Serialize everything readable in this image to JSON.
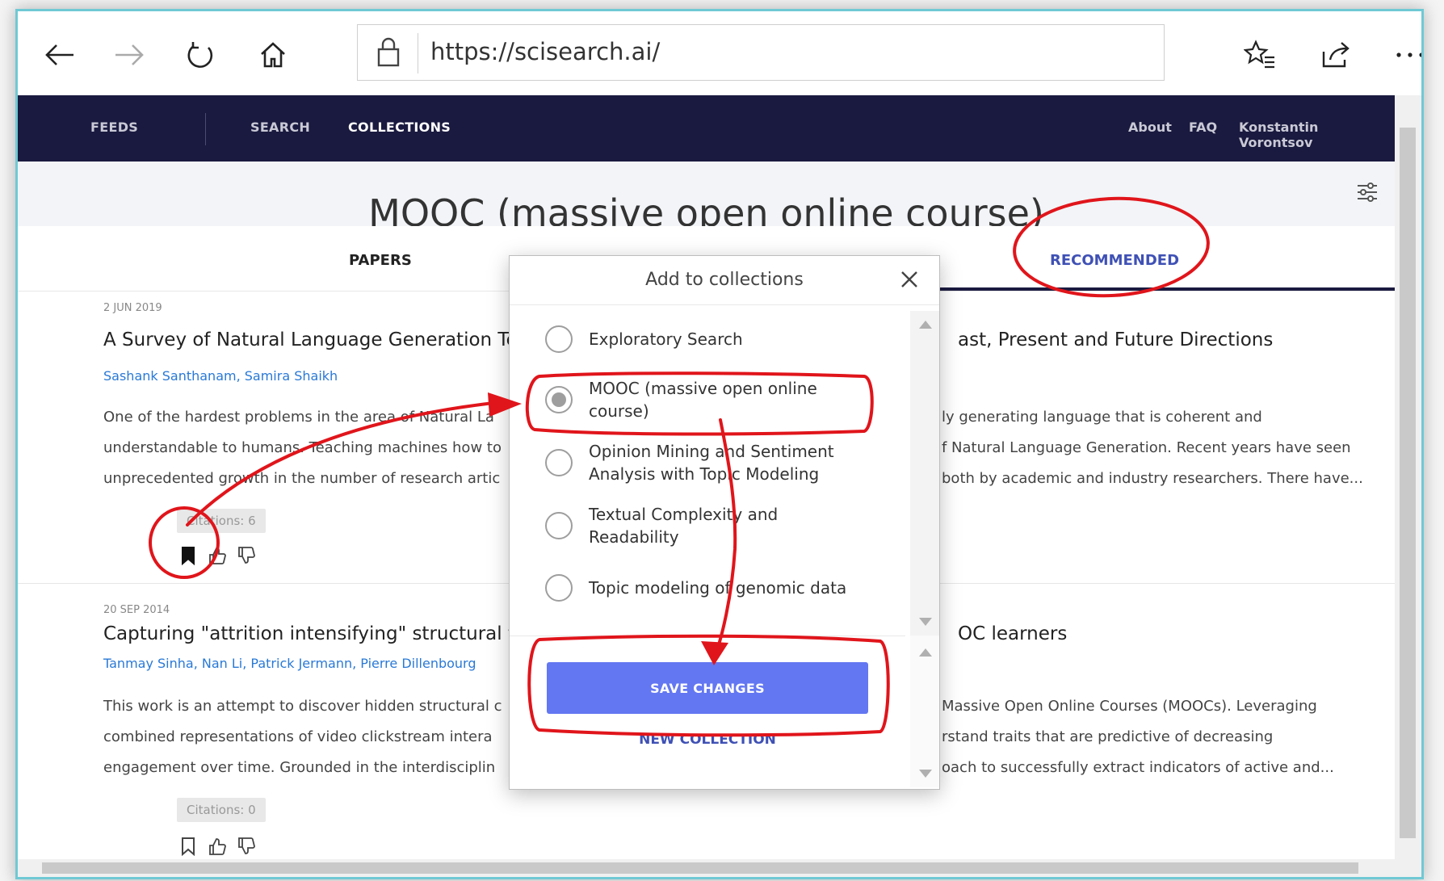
{
  "browser": {
    "url": "https://scisearch.ai/"
  },
  "nav": {
    "feeds": "FEEDS",
    "search": "SEARCH",
    "collections": "COLLECTIONS",
    "about": "About",
    "faq": "FAQ",
    "user": "Konstantin Vorontsov"
  },
  "page": {
    "title": "MOOC (massive open online course)",
    "tabs": [
      "PAPERS",
      "RECOMMENDED"
    ]
  },
  "papers": [
    {
      "date": "2 JUN 2019",
      "title_left": "A Survey of Natural Language Generation Te",
      "title_right": "ast, Present and Future Directions",
      "authors": "Sashank Santhanam, Samira Shaikh",
      "abstract_left": [
        "One of the hardest problems in the area of Natural La",
        "understandable to humans. Teaching machines how to",
        "unprecedented growth in the number of research artic"
      ],
      "abstract_right": [
        "ly generating language that is coherent and",
        "f Natural Language Generation. Recent years have seen",
        "both by academic and industry researchers. There have..."
      ],
      "citations": "Citations: 6"
    },
    {
      "date": "20 SEP 2014",
      "title_left": "Capturing \"attrition intensifying\" structural t",
      "title_right": "OC learners",
      "authors": "Tanmay Sinha, Nan Li, Patrick Jermann, Pierre Dillenbourg",
      "abstract_left": [
        "This work is an attempt to discover hidden structural c",
        "combined representations of video clickstream intera",
        "engagement over time. Grounded in the interdisciplin"
      ],
      "abstract_right": [
        "Massive Open Online Courses (MOOCs). Leveraging",
        "rstand traits that are predictive of decreasing",
        "oach to successfully extract indicators of active and..."
      ],
      "citations": "Citations: 0"
    }
  ],
  "modal": {
    "title": "Add to collections",
    "options": [
      {
        "label": "Exploratory Search",
        "checked": false
      },
      {
        "label": "MOOC (massive open online course)",
        "checked": true
      },
      {
        "label": "Opinion Mining and Sentiment Analysis with Topic Modeling",
        "checked": false
      },
      {
        "label": "Textual Complexity and Readability",
        "checked": false
      },
      {
        "label": "Topic modeling of genomic data",
        "checked": false
      }
    ],
    "save_label": "SAVE CHANGES",
    "new_collection_label": "NEW COLLECTION"
  },
  "colors": {
    "nav_bg": "#1a1a40",
    "accent": "#3f51b5",
    "save_button": "#6377f2",
    "annotation": "#e0151b",
    "link": "#2979d6"
  }
}
